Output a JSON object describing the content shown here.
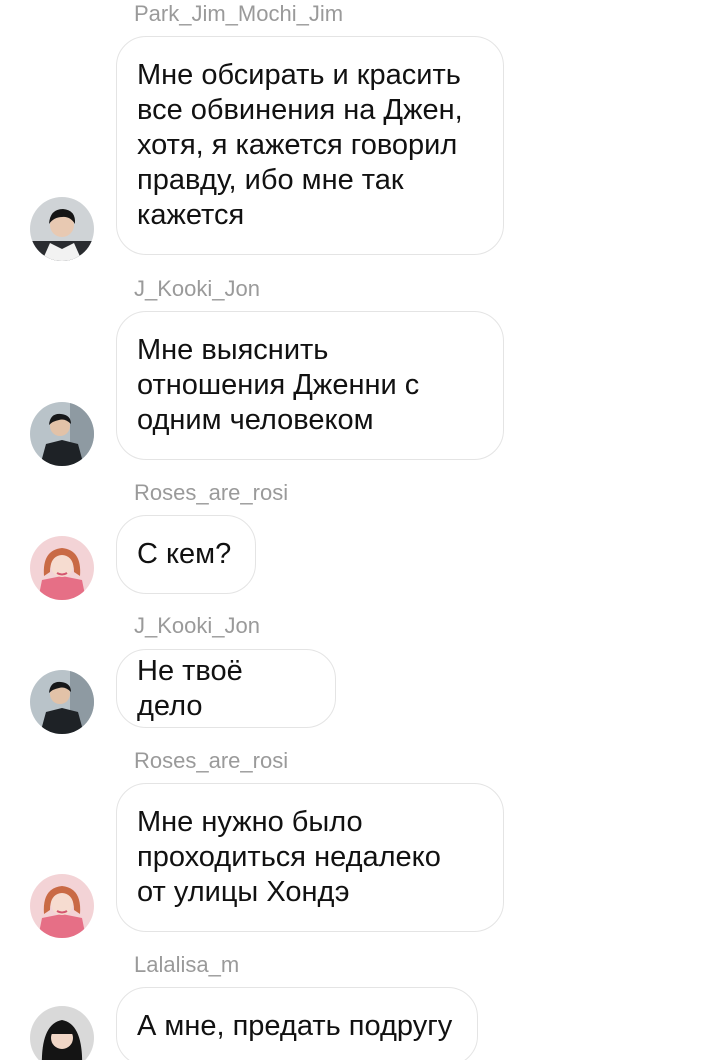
{
  "messages": [
    {
      "sender": "Park_Jim_Mochi_Jim",
      "text": "Мне обсирать и красить\nвсе обвинения на Джен,\nхотя, я кажется говорил\nправду, ибо мне так\nкажется",
      "avatar": "profile-photo-jimin"
    },
    {
      "sender": "J_Kooki_Jon",
      "text": "Мне выяснить\nотношения Дженни с\nодним человеком",
      "avatar": "profile-photo-jungkook"
    },
    {
      "sender": "Roses_are_rosi",
      "text": "С кем?",
      "avatar": "profile-photo-rose"
    },
    {
      "sender": "J_Kooki_Jon",
      "text": "Не твоё дело",
      "avatar": "profile-photo-jungkook"
    },
    {
      "sender": "Roses_are_rosi",
      "text": "Мне нужно было\nпроходиться недалеко\nот улицы Хондэ",
      "avatar": "profile-photo-rose"
    },
    {
      "sender": "Lalalisa_m",
      "text": "А мне, предать подругу",
      "avatar": "profile-photo-lisa"
    }
  ],
  "colors": {
    "sender_text": "#9a9a9a",
    "bubble_border": "#e4e4e4",
    "message_text": "#111111",
    "background": "#ffffff"
  }
}
